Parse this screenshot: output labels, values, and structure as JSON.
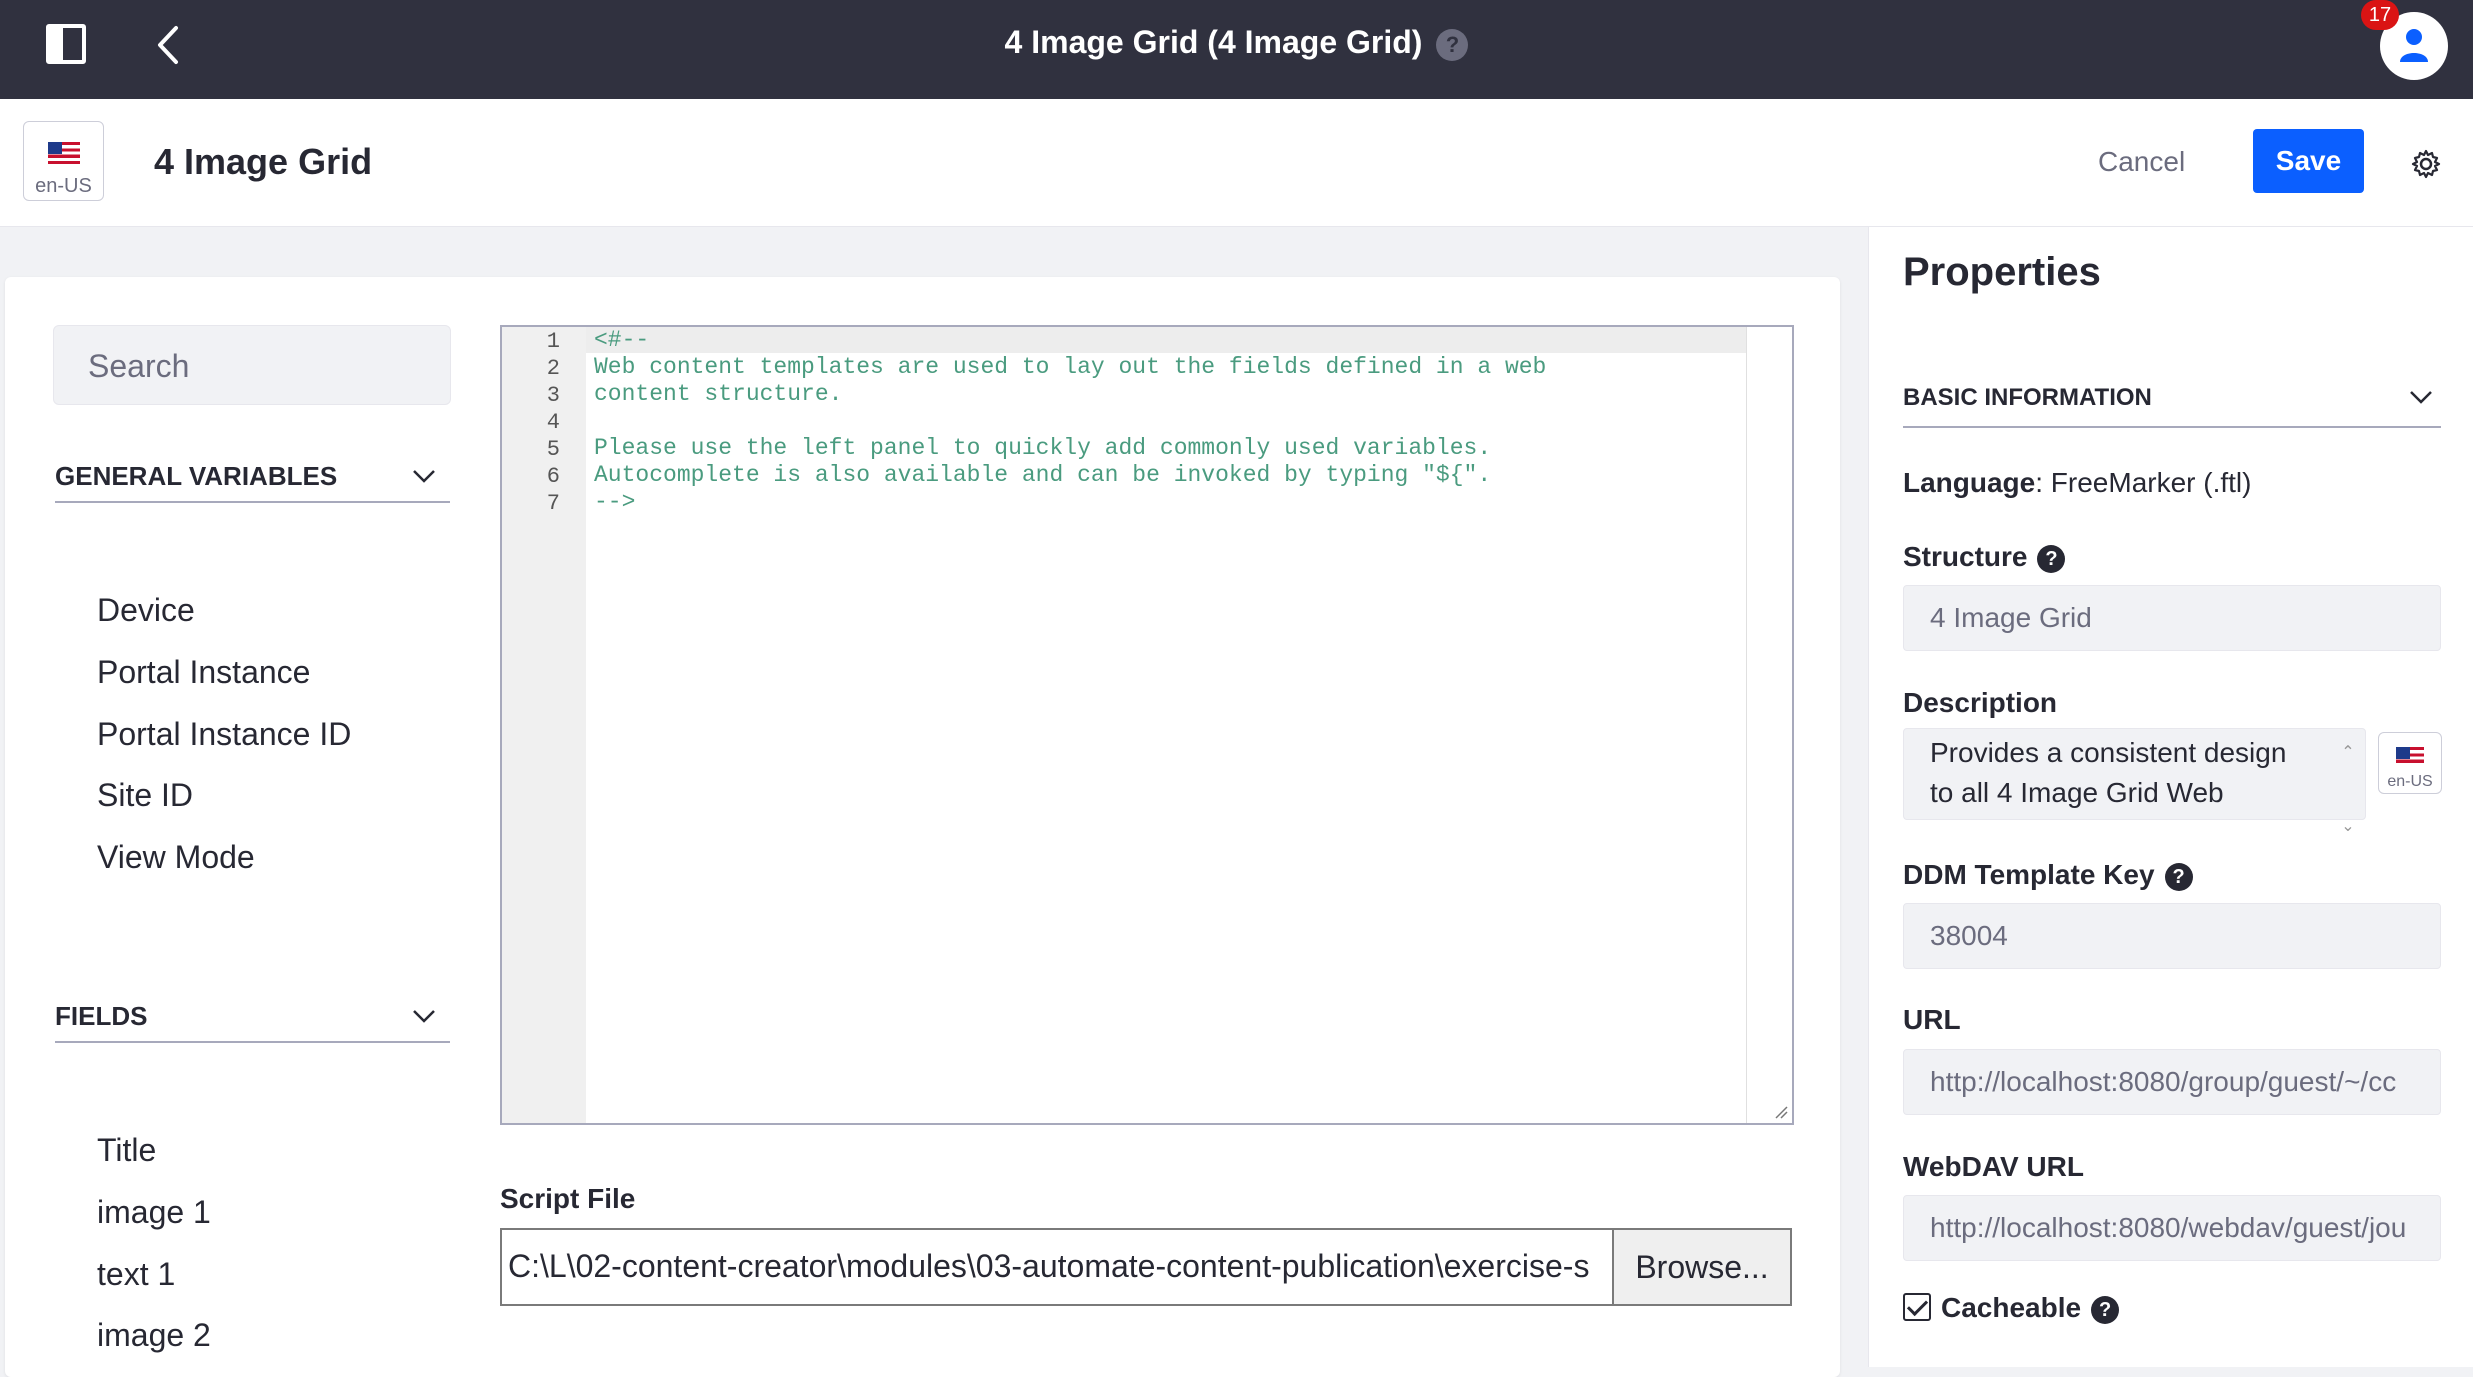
{
  "header": {
    "title": "4 Image Grid (4 Image Grid)",
    "help_icon": "?",
    "notification_count": "17"
  },
  "toolbar": {
    "locale": "en-US",
    "page_title": "4 Image Grid",
    "cancel_label": "Cancel",
    "save_label": "Save"
  },
  "left_panel": {
    "search_placeholder": "Search",
    "general_variables": {
      "heading": "GENERAL VARIABLES",
      "items": [
        "Device",
        "Portal Instance",
        "Portal Instance ID",
        "Site ID",
        "View Mode"
      ]
    },
    "fields": {
      "heading": "FIELDS",
      "items": [
        "Title",
        "image 1",
        "text 1",
        "image 2"
      ]
    }
  },
  "editor": {
    "line_numbers": [
      "1",
      "2",
      "3",
      "4",
      "5",
      "6",
      "7"
    ],
    "lines": [
      "<#--",
      "Web content templates are used to lay out the fields defined in a web",
      "content structure.",
      "",
      "Please use the left panel to quickly add commonly used variables.",
      "Autocomplete is also available and can be invoked by typing \"${\".",
      "-->"
    ]
  },
  "script_file": {
    "label": "Script File",
    "value": "C:\\L\\02-content-creator\\modules\\03-automate-content-publication\\exercise-s",
    "browse_label": "Browse..."
  },
  "properties": {
    "title": "Properties",
    "section": "BASIC INFORMATION",
    "language_label": "Language",
    "language_value": ": FreeMarker (.ftl)",
    "structure_label": "Structure",
    "structure_value": "4 Image Grid",
    "description_label": "Description",
    "description_line1": "Provides a consistent design",
    "description_line2": "to all 4 Image Grid Web",
    "description_locale": "en-US",
    "ddm_key_label": "DDM Template Key",
    "ddm_key_value": "38004",
    "url_label": "URL",
    "url_value": "http://localhost:8080/group/guest/~/cc",
    "webdav_label": "WebDAV URL",
    "webdav_value": "http://localhost:8080/webdav/guest/jou",
    "cacheable_label": "Cacheable"
  }
}
